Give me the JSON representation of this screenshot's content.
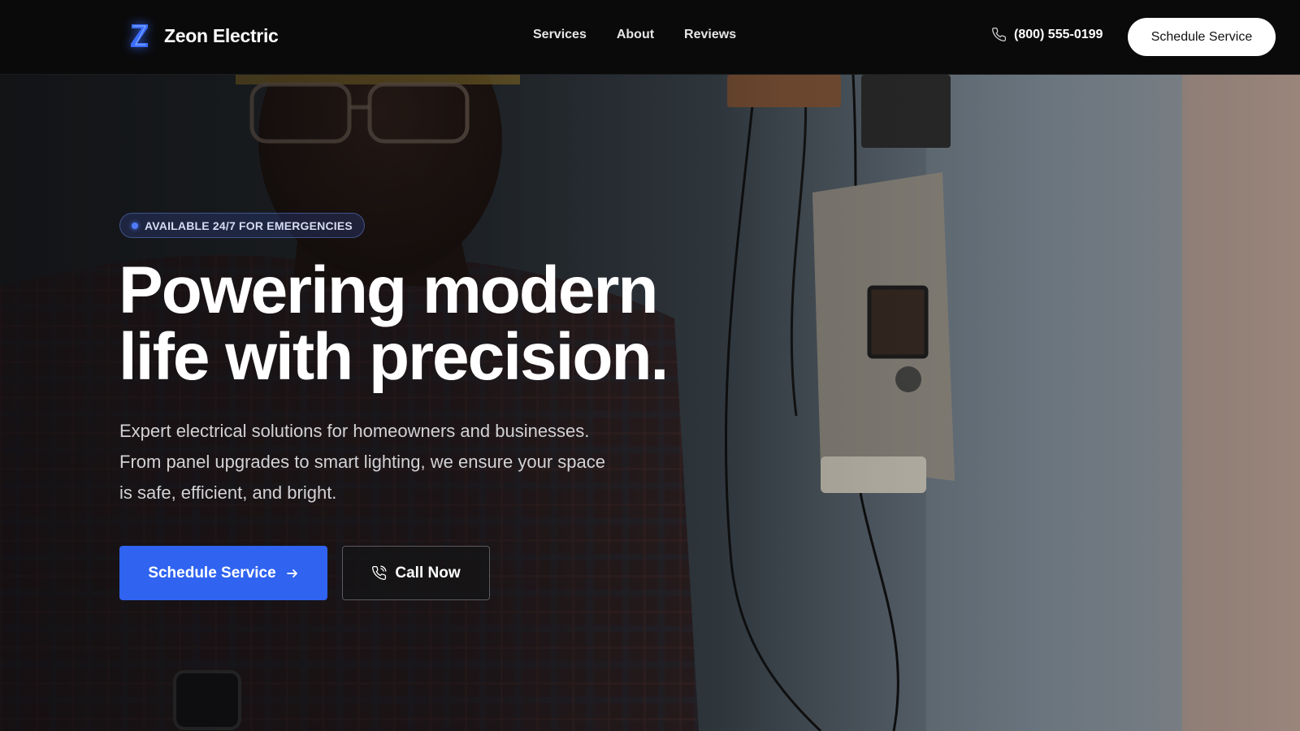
{
  "nav": {
    "brand_name": "Zeon Electric",
    "logo_letter": "Z",
    "links": [
      "Services",
      "About",
      "Reviews"
    ],
    "phone_number": "(800) 555-0199",
    "cta_label": "Schedule Service"
  },
  "hero": {
    "badge": "AVAILABLE 24/7 FOR EMERGENCIES",
    "headline_line1": "Powering modern",
    "headline_line2": "life with precision.",
    "subtext": "Expert electrical solutions for homeowners and businesses. From panel upgrades to smart lighting, we ensure your space is safe, efficient, and bright.",
    "primary_button": "Schedule Service",
    "secondary_button": "Call Now"
  },
  "icons": {
    "logo": "lightning-z-icon",
    "phone": "phone-icon",
    "arrow": "arrow-right-icon",
    "call": "phone-call-icon"
  },
  "colors": {
    "accent": "#2f63f0",
    "nav_bg": "#0a0a0b",
    "badge_dot": "#4f7cff"
  }
}
